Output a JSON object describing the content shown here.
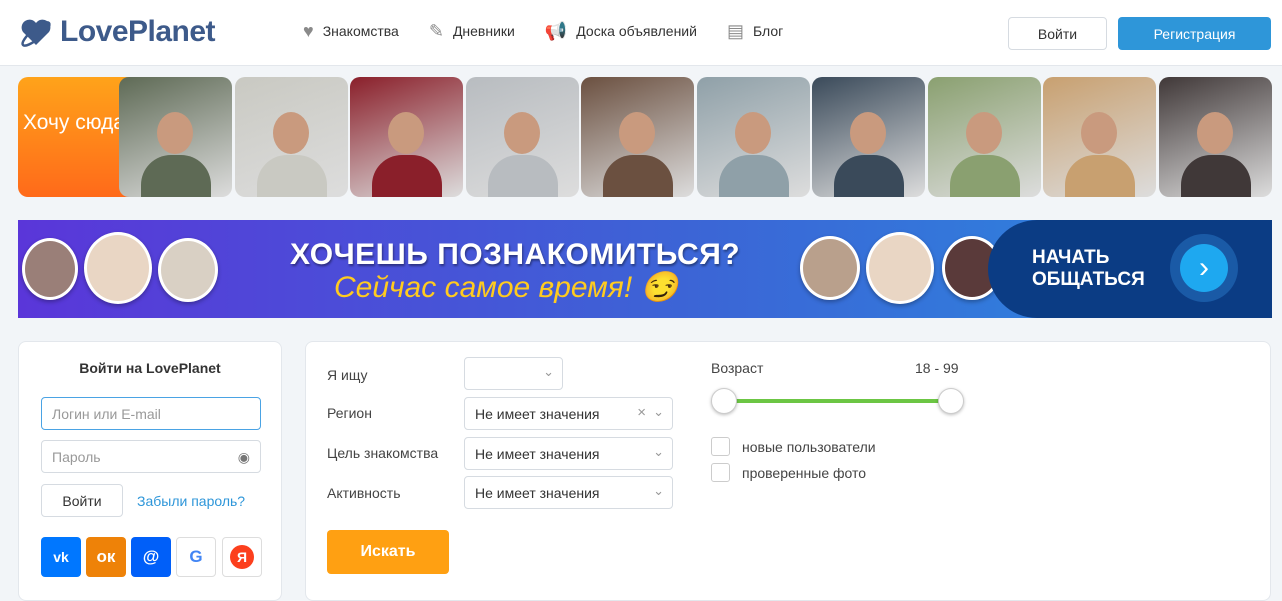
{
  "header": {
    "logo": "LovePlanet",
    "nav": [
      {
        "label": "Знакомства",
        "icon": "heart-icon"
      },
      {
        "label": "Дневники",
        "icon": "pencil-icon"
      },
      {
        "label": "Доска объявлений",
        "icon": "megaphone-icon"
      },
      {
        "label": "Блог",
        "icon": "document-icon"
      }
    ],
    "login": "Войти",
    "register": "Регистрация"
  },
  "strip": {
    "want_here": "Хочу сюда",
    "photos": [
      "#5e6a55",
      "#c9c9c2",
      "#8a1f2a",
      "#b8bcc0",
      "#6b5040",
      "#8fa0a8",
      "#3a4a5a",
      "#8aa070",
      "#c8a070",
      "#403838"
    ]
  },
  "banner": {
    "headline": "ХОЧЕШЬ ПОЗНАКОМИТЬСЯ?",
    "subline": "Сейчас самое время! 😏",
    "cta_line1": "НАЧАТЬ",
    "cta_line2": "ОБЩАТЬСЯ"
  },
  "login": {
    "title": "Войти на LovePlanet",
    "login_placeholder": "Логин или E-mail",
    "password_placeholder": "Пароль",
    "submit": "Войти",
    "forgot": "Забыли пароль?",
    "social": [
      {
        "name": "vk",
        "label": "vk",
        "color": "#0077ff"
      },
      {
        "name": "ok",
        "label": "ок",
        "color": "#ee8208"
      },
      {
        "name": "mail",
        "label": "@",
        "color": "#005ff9"
      },
      {
        "name": "google",
        "label": "G",
        "color": "#ffffff"
      },
      {
        "name": "yandex",
        "label": "Я",
        "color": "#ffffff"
      }
    ]
  },
  "search": {
    "seeking_label": "Я ищу",
    "seeking_value": "",
    "region_label": "Регион",
    "region_value": "Не имеет значения",
    "goal_label": "Цель знакомства",
    "goal_value": "Не имеет значения",
    "activity_label": "Активность",
    "activity_value": "Не имеет значения",
    "submit": "Искать",
    "age_label": "Возраст",
    "age_range": "18 - 99",
    "age_min": 18,
    "age_max": 99,
    "new_users": "новые пользователи",
    "verified_photos": "проверенные фото"
  }
}
